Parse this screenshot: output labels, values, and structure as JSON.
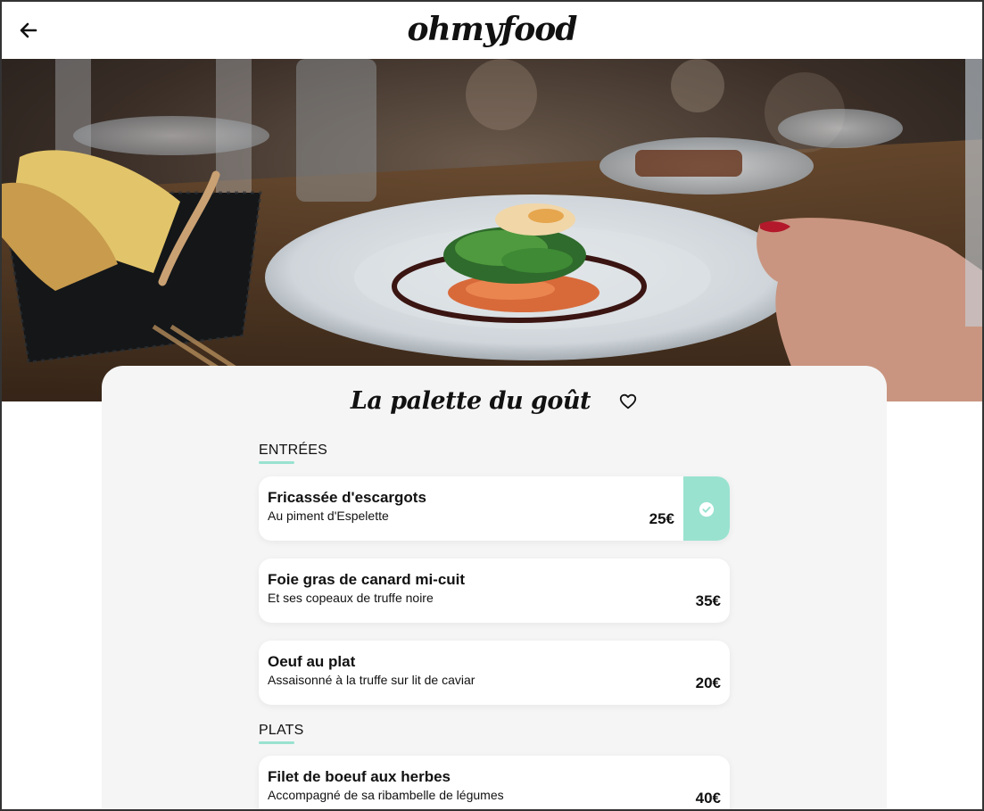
{
  "header": {
    "brand": "ohmyfood",
    "back_icon": "arrow-left-icon"
  },
  "hero": {
    "image": "restaurant-dish-photo"
  },
  "restaurant": {
    "name": "La palette du goût",
    "favorite_icon": "heart-outline-icon"
  },
  "menu": {
    "sections": [
      {
        "title": "ENTRÉES",
        "dishes": [
          {
            "name": "Fricassée d'escargots",
            "description": "Au piment d'Espelette",
            "price": "25€",
            "selected": true
          },
          {
            "name": "Foie gras de canard mi-cuit",
            "description": "Et ses copeaux de truffe noire",
            "price": "35€",
            "selected": false
          },
          {
            "name": "Oeuf au plat",
            "description": "Assaisonné à la truffe sur lit de caviar",
            "price": "20€",
            "selected": false
          }
        ]
      },
      {
        "title": "PLATS",
        "dishes": [
          {
            "name": "Filet de boeuf aux herbes",
            "description": "Accompagné de sa ribambelle de légumes",
            "price": "40€",
            "selected": false
          }
        ]
      }
    ]
  },
  "colors": {
    "accent": "#99e2d0",
    "card_bg": "#f5f5f5",
    "text": "#111111"
  }
}
